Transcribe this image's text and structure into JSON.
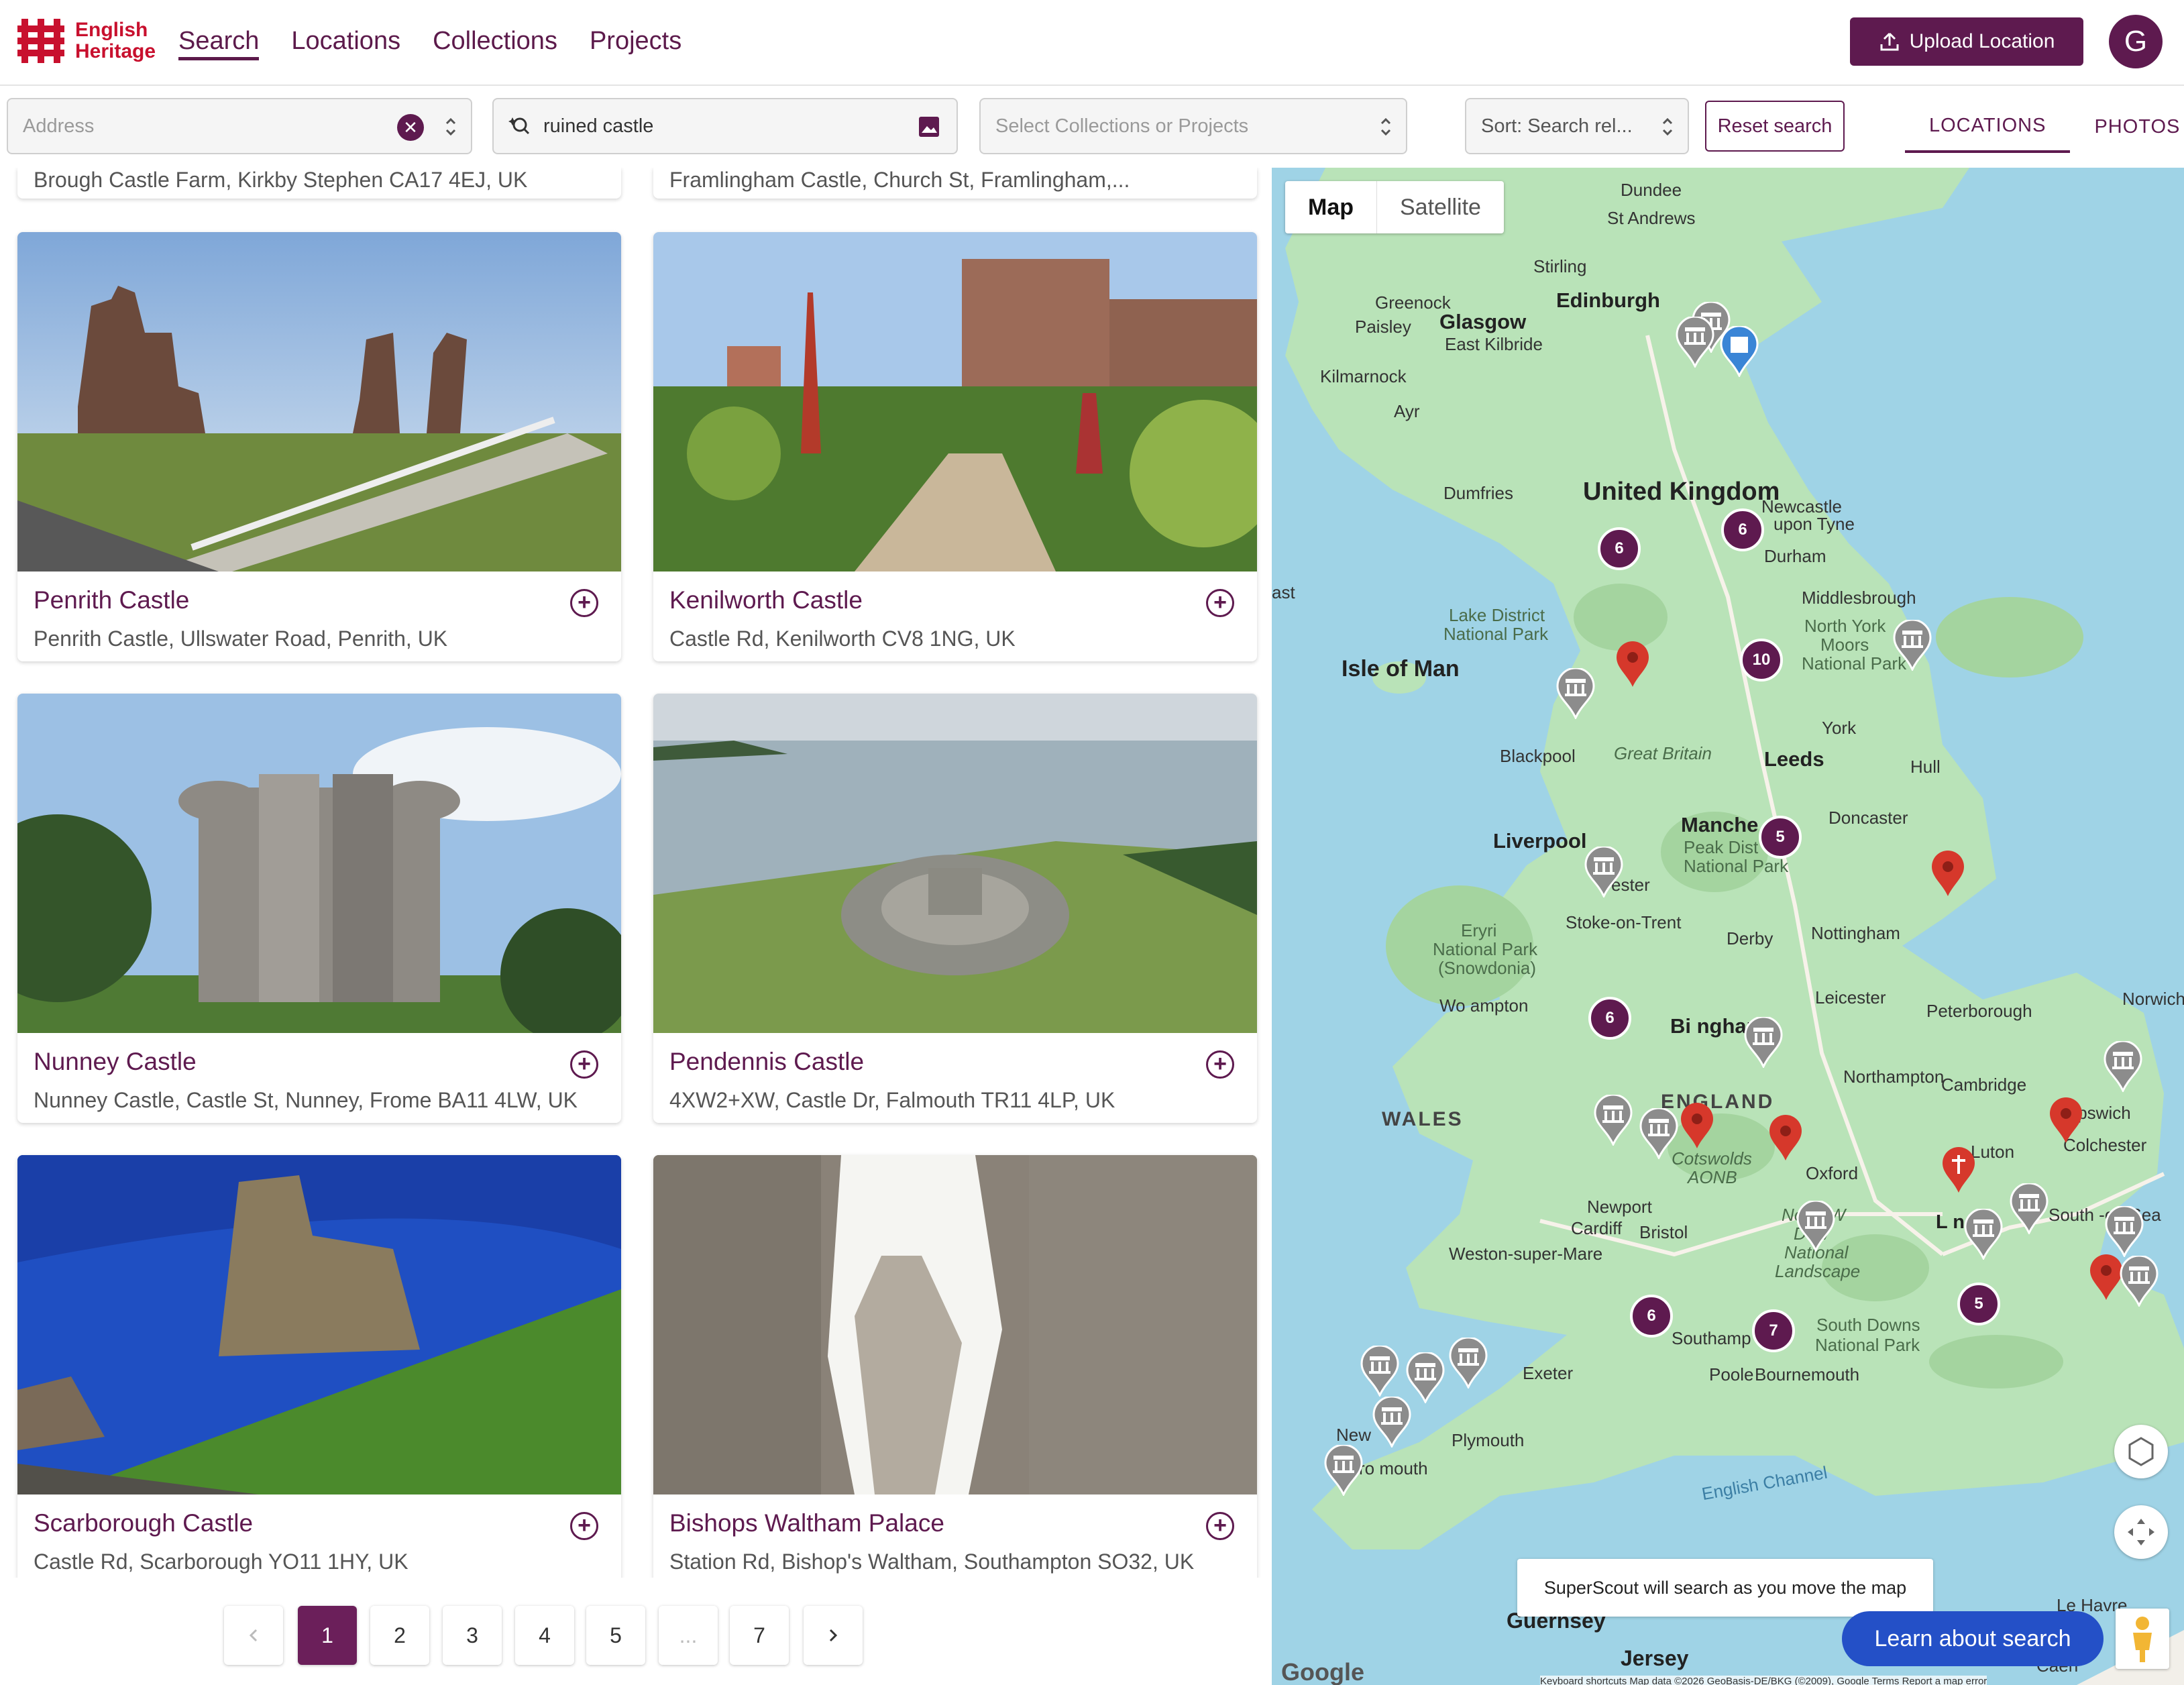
{
  "brand": {
    "line1": "English",
    "line2": "Heritage"
  },
  "nav": [
    {
      "label": "Search",
      "active": true
    },
    {
      "label": "Locations"
    },
    {
      "label": "Collections"
    },
    {
      "label": "Projects"
    }
  ],
  "header": {
    "upload_label": "Upload Location",
    "avatar_initial": "G"
  },
  "filters": {
    "address_placeholder": "Address",
    "search_value": "ruined castle",
    "collections_placeholder": "Select Collections or Projects",
    "sort_value": "Sort: Search rel...",
    "reset_label": "Reset search",
    "tab_locations": "LOCATIONS",
    "tab_photos": "PHOTOS"
  },
  "top_partial": [
    "Brough Castle Farm, Kirkby Stephen CA17 4EJ, UK",
    "Framlingham Castle, Church St, Framlingham,..."
  ],
  "results": [
    {
      "title": "Penrith Castle",
      "address": "Penrith Castle, Ullswater Road, Penrith, UK"
    },
    {
      "title": "Kenilworth Castle",
      "address": "Castle Rd, Kenilworth CV8 1NG, UK"
    },
    {
      "title": "Nunney Castle",
      "address": "Nunney Castle, Castle St, Nunney, Frome BA11 4LW, UK"
    },
    {
      "title": "Pendennis Castle",
      "address": "4XW2+XW, Castle Dr, Falmouth TR11 4LP, UK"
    },
    {
      "title": "Scarborough Castle",
      "address": "Castle Rd, Scarborough YO11 1HY, UK"
    },
    {
      "title": "Bishops Waltham Palace",
      "address": "Station Rd, Bishop's Waltham, Southampton SO32, UK"
    }
  ],
  "pagination": {
    "pages": [
      "1",
      "2",
      "3",
      "4",
      "5",
      "...",
      "7"
    ],
    "current": "1"
  },
  "map": {
    "type_map": "Map",
    "type_satellite": "Satellite",
    "labels": {
      "country": "United Kingdom",
      "isle": "Isle of Man",
      "england": "ENGLAND",
      "wales": "WALES",
      "edinburgh": "Edinburgh",
      "glasgow": "Glasgow",
      "dundee": "Dundee",
      "standrews": "St Andrews",
      "stirling": "Stirling",
      "greenock": "Greenock",
      "paisley": "Paisley",
      "eastkilbride": "East Kilbride",
      "kilmarnock": "Kilmarnock",
      "ayr": "Ayr",
      "dumfries": "Dumfries",
      "newcastle1": "Newcastle",
      "newcastle2": "upon Tyne",
      "durham": "Durham",
      "middlesbrough": "Middlesbrough",
      "northyork1": "North York",
      "northyork2": "Moors",
      "northyork3": "National Park",
      "lakedistrict1": "Lake District",
      "lakedistrict2": "National Park",
      "york": "York",
      "leeds": "Leeds",
      "hull": "Hull",
      "blackpool": "Blackpool",
      "greatbritain": "Great Britain",
      "liverpool": "Liverpool",
      "manchester": "Manche",
      "doncaster": "Doncaster",
      "peak1": "Peak Dist",
      "peak2": "National Park",
      "chester": "ester",
      "stoke": "Stoke-on-Trent",
      "nottingham": "Nottingham",
      "derby": "Derby",
      "eryri1": "Eryri",
      "eryri2": "National Park",
      "eryri3": "(Snowdonia)",
      "leicester": "Leicester",
      "peterborough": "Peterborough",
      "norwich": "Norwich",
      "wolverhampton": "Wo   ampton",
      "birmingham": "Bi     ngham",
      "northampton": "Northampton",
      "cambridge": "Cambridge",
      "ipswich": "Ipswich",
      "colchester": "Colchester",
      "cotswolds1": "Cotswolds",
      "cotswolds2": "AONB",
      "oxford": "Oxford",
      "luton": "Luton",
      "newport": "Newport",
      "cardiff": "Cardiff",
      "bristol": "Bristol",
      "london": "L    n",
      "southend": "South    -on-Sea",
      "northwessex1": "North W",
      "northwessex2": "Dow",
      "northwessex3": "National",
      "northwessex4": "Landscape",
      "westonsm": "Weston-super-Mare",
      "southdowns1": "South Downs",
      "southdowns2": "National Park",
      "southampton": "Southamp",
      "exeter": "Exeter",
      "poole": "Poole",
      "bournemouth": "Bournemouth",
      "plymouth": "Plymouth",
      "newquay": "New",
      "falmouth": "ro    mouth",
      "englishchannel": "English Channel",
      "guernsey": "Guernsey",
      "jersey": "Jersey",
      "lehavre": "Le Havre",
      "caen": "Caen",
      "east": "ast"
    },
    "clusters": [
      "6",
      "6",
      "10",
      "5",
      "6",
      "6",
      "7",
      "5"
    ],
    "tooltip": "SuperScout will search as you move the map",
    "learn_label": "Learn about search",
    "google": "Google",
    "attribution": "Keyboard shortcuts    Map data ©2026 GeoBasis-DE/BKG (©2009), Google    Terms    Report a map error"
  },
  "colors": {
    "brand_purple": "#5e1a4f",
    "brand_red": "#c8102e",
    "map_water": "#9fd3e6",
    "map_land": "#b9e3b8",
    "learn_blue": "#2450c7"
  }
}
